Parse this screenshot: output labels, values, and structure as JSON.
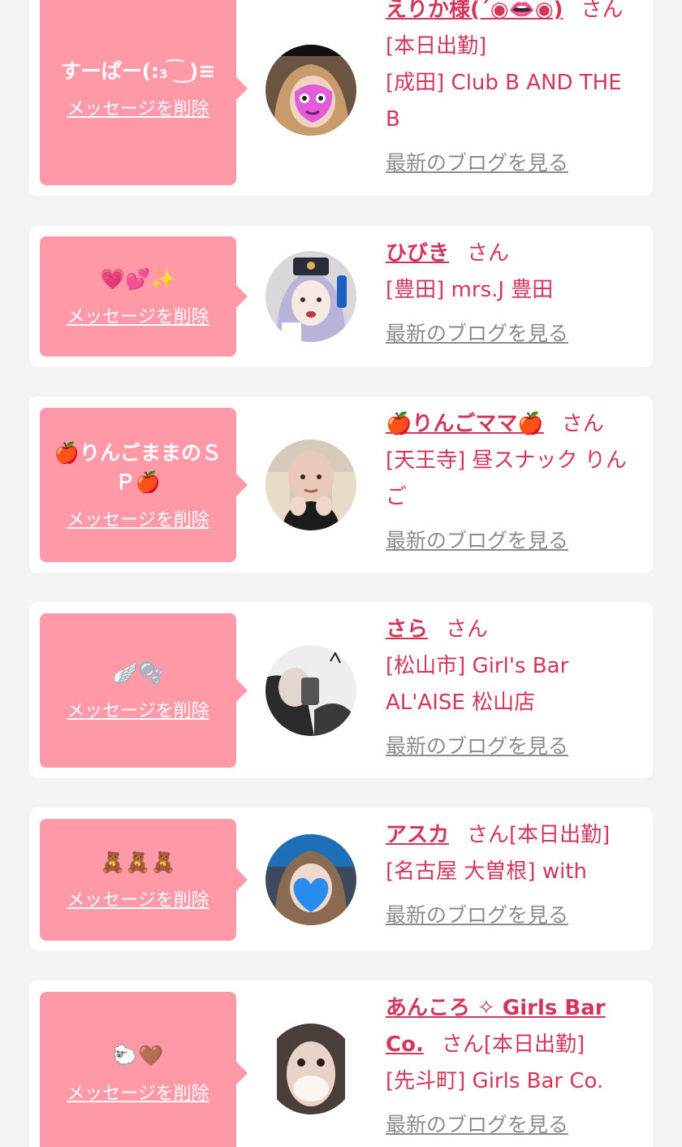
{
  "entries": [
    {
      "tag_text": "すーぱー(:₃ ͡ ͜ )≡",
      "delete_label": "メッセージを削除",
      "name": "えりか様(´◉👄◉)",
      "san": "さん",
      "status": "[本日出勤]",
      "location": "[成田] Club B AND THE B",
      "blog_label": "最新のブログを見る"
    },
    {
      "tag_text": "💗💕✨",
      "delete_label": "メッセージを削除",
      "name": "ひびき",
      "san": "さん",
      "status": "",
      "location": "[豊田] mrs.J 豊田",
      "blog_label": "最新のブログを見る"
    },
    {
      "tag_text": "🍎りんごままのＳＰ🍎",
      "delete_label": "メッセージを削除",
      "name": "🍎りんごママ🍎",
      "san": "さん",
      "status": "",
      "location": "[天王寺] 昼スナック りんご",
      "blog_label": "最新のブログを見る"
    },
    {
      "tag_text": "🪽🫧",
      "delete_label": "メッセージを削除",
      "name": "さら",
      "san": "さん",
      "status": "",
      "location": "[松山市] Girl's Bar AL'AISE 松山店",
      "blog_label": "最新のブログを見る"
    },
    {
      "tag_text": "🧸🧸🧸",
      "delete_label": "メッセージを削除",
      "name": "アスカ",
      "san": "さん",
      "status": "[本日出勤]",
      "location": "[名古屋 大曽根] with",
      "blog_label": "最新のブログを見る"
    },
    {
      "tag_text": "🐑🤎",
      "delete_label": "メッセージを削除",
      "name": "あんころ ✧ Girls Bar Co.",
      "san": "さん",
      "status": "[本日出勤]",
      "location": "[先斗町] Girls Bar Co.",
      "blog_label": "最新のブログを見る"
    }
  ],
  "colors": {
    "accent": "#d2365a",
    "tag_bg": "#ff98a7",
    "blog_link": "#8c8c8c",
    "page_bg": "#f3f3f3",
    "card_bg": "#ffffff"
  }
}
